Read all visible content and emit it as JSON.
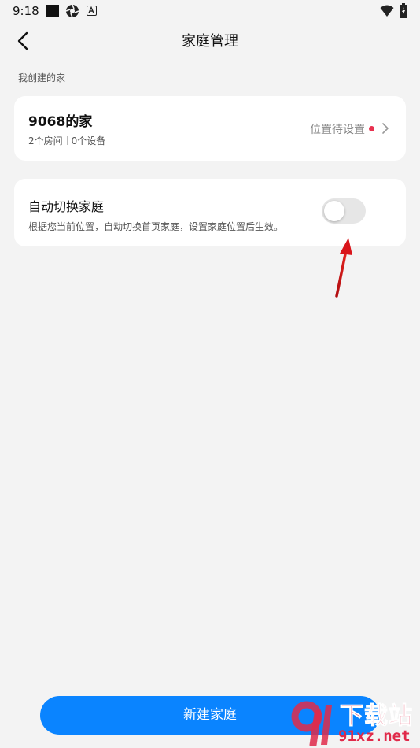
{
  "status_bar": {
    "time": "9:18",
    "left_icons": [
      "stop-square-icon",
      "aperture-icon",
      "a-box-icon"
    ],
    "right_icons": [
      "wifi-icon",
      "battery-charging-icon"
    ]
  },
  "header": {
    "title": "家庭管理",
    "back_icon": "chevron-left-icon"
  },
  "section": {
    "label": "我创建的家"
  },
  "home_card": {
    "name": "9068的家",
    "rooms": "2个房间",
    "devices": "0个设备",
    "location_status": "位置待设置",
    "dot_color": "#e8314f"
  },
  "auto_switch": {
    "title": "自动切换家庭",
    "description": "根据您当前位置，自动切换首页家庭，设置家庭位置后生效。",
    "enabled": false
  },
  "new_home_button": {
    "label": "新建家庭",
    "color": "#0a84ff"
  },
  "watermark": {
    "title": "下载站",
    "url": "91xz.net",
    "color": "#e02a4a"
  },
  "colors": {
    "background": "#f3f3f3",
    "card": "#ffffff",
    "accent": "#0a84ff",
    "annotation_arrow": "#d9151b"
  }
}
